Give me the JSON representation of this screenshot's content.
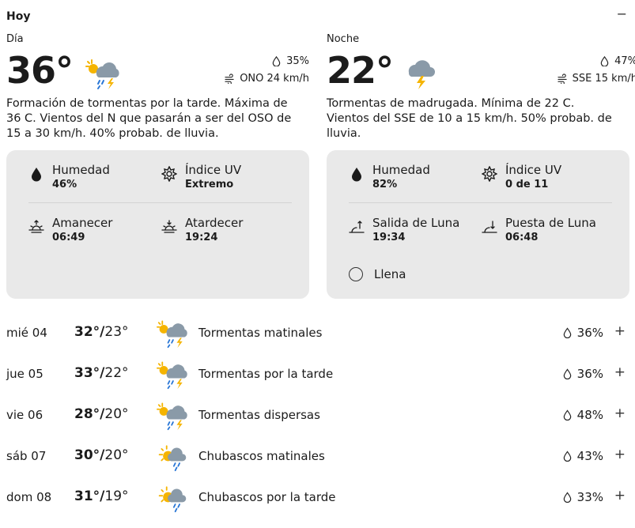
{
  "header": {
    "title": "Hoy",
    "collapse_symbol": "−"
  },
  "day": {
    "label": "Día",
    "temp": "36°",
    "icon": "sun-cloud-rain-storm-icon",
    "precip": "35%",
    "wind": "ONO 24 km/h",
    "description": "Formación de tormentas por la tarde. Máxima de 36 C. Vientos del N que pasarán a ser del OSO de 15 a 30 km/h. 40% probab. de lluvia.",
    "details": {
      "humidity_label": "Humedad",
      "humidity_value": "46%",
      "uv_label": "Índice UV",
      "uv_value": "Extremo",
      "sunrise_label": "Amanecer",
      "sunrise_value": "06:49",
      "sunset_label": "Atardecer",
      "sunset_value": "19:24"
    }
  },
  "night": {
    "label": "Noche",
    "temp": "22°",
    "icon": "cloud-storm-icon",
    "precip": "47%",
    "wind": "SSE 15 km/h",
    "description": "Tormentas de madrugada. Mínima de 22 C. Vientos del SSE de 10 a 15 km/h. 50% probab. de lluvia.",
    "details": {
      "humidity_label": "Humedad",
      "humidity_value": "82%",
      "uv_label": "Índice UV",
      "uv_value": "0 de 11",
      "moonrise_label": "Salida de Luna",
      "moonrise_value": "19:34",
      "moonset_label": "Puesta de Luna",
      "moonset_value": "06:48",
      "moon_phase": "Llena"
    }
  },
  "forecast": [
    {
      "day": "mié 04",
      "hi": "32°",
      "lo": "23°",
      "condition": "Tormentas matinales",
      "precip": "36%",
      "icon": "sun-cloud-rain-storm-icon"
    },
    {
      "day": "jue 05",
      "hi": "33°",
      "lo": "22°",
      "condition": "Tormentas por la tarde",
      "precip": "36%",
      "icon": "sun-cloud-rain-storm-icon"
    },
    {
      "day": "vie 06",
      "hi": "28°",
      "lo": "20°",
      "condition": "Tormentas dispersas",
      "precip": "48%",
      "icon": "sun-cloud-rain-storm-icon"
    },
    {
      "day": "sáb 07",
      "hi": "30°",
      "lo": "20°",
      "condition": "Chubascos matinales",
      "precip": "43%",
      "icon": "sun-cloud-rain-icon"
    },
    {
      "day": "dom 08",
      "hi": "31°",
      "lo": "19°",
      "condition": "Chubascos por la tarde",
      "precip": "33%",
      "icon": "sun-cloud-rain-icon"
    }
  ],
  "expand_symbol": "+",
  "temp_separator": "/",
  "colors": {
    "card_bg": "#e9e9e9",
    "sun": "#f5b400",
    "cloud": "#8a9aa8",
    "bolt": "#f5b400",
    "rain": "#2a77d6"
  }
}
